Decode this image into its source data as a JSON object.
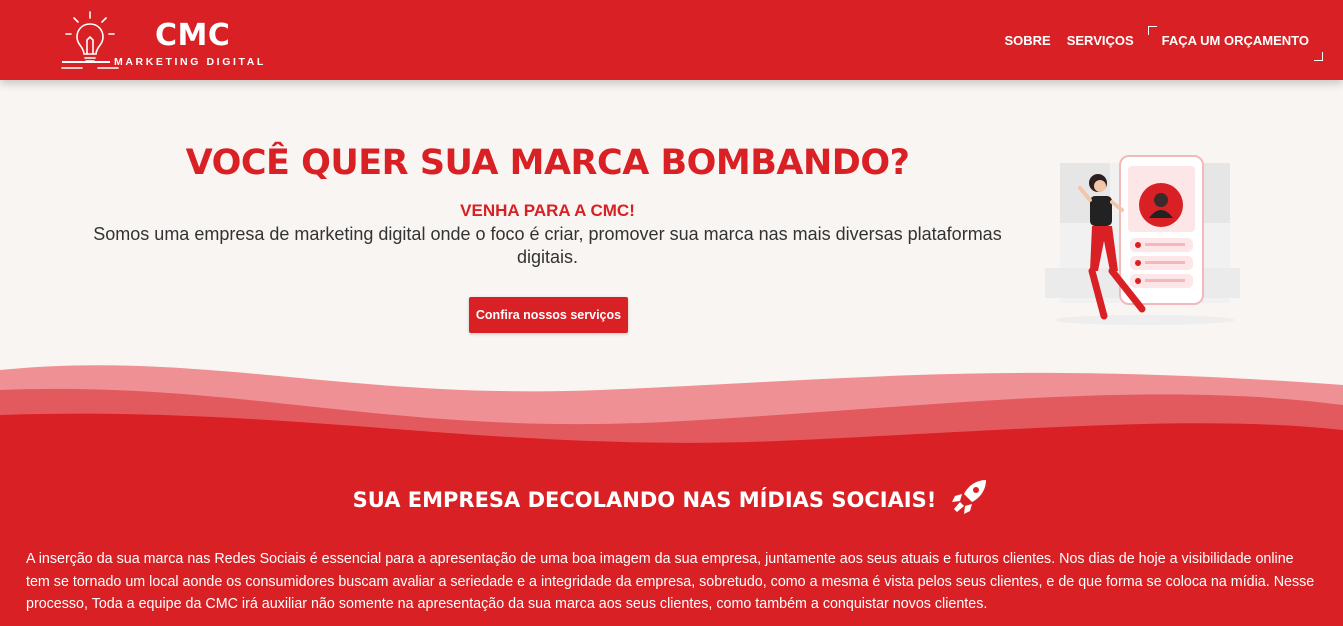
{
  "brand": {
    "name": "CMC",
    "tagline": "MARKETING DIGITAL",
    "color": "#d92025"
  },
  "nav": {
    "items": [
      "SOBRE",
      "SERVIÇOS"
    ],
    "cta": "FAÇA UM ORÇAMENTO"
  },
  "hero": {
    "title": "VOCÊ QUER SUA MARCA BOMBANDO?",
    "subtitle": "VENHA PARA A CMC!",
    "description": "Somos uma empresa de marketing digital onde o foco é criar, promover sua marca nas mais diversas plataformas digitais.",
    "button": "Confira nossos serviços",
    "illustration": "woman-phone-illustration"
  },
  "social": {
    "title": "SUA EMPRESA DECOLANDO NAS MÍDIAS SOCIAIS!",
    "icon": "rocket-icon",
    "text": "A inserção da sua marca nas Redes Sociais é essencial para a apresentação de uma boa imagem da sua empresa, juntamente aos seus atuais e futuros clientes. Nos dias de hoje a visibilidade online tem se tornado um local aonde os consumidores buscam avaliar a seriedade e a integridade da empresa, sobretudo, como a mesma é vista pelos seus clientes, e de que forma se coloca na mídia. Nesse processo, Toda a equipe da CMC irá auxiliar não somente na apresentação da sua marca aos seus clientes, como também a conquistar novos clientes."
  }
}
